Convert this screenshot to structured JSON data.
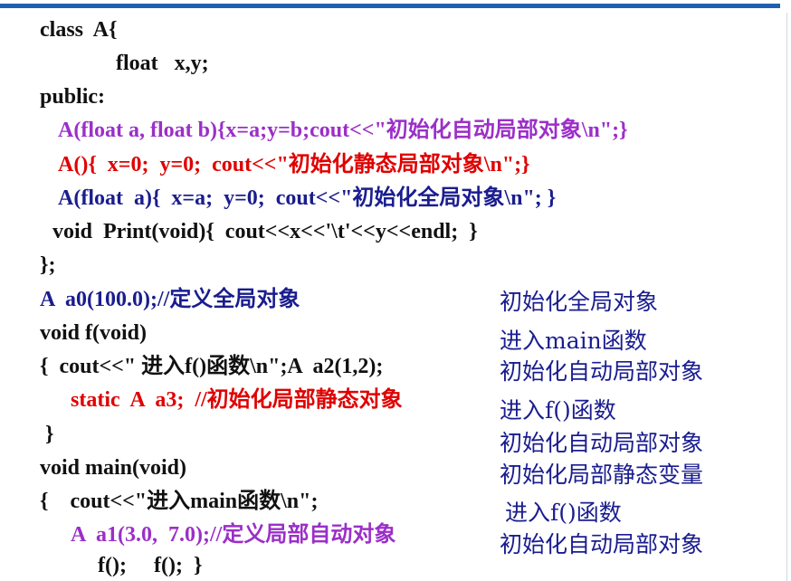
{
  "code_lines": [
    "class  A{",
    "float   x,y;",
    "public:",
    "A(float a, float b){x=a;y=b;cout<<\"初始化自动局部对象\\n\";}",
    "A(){  x=0;  y=0;  cout<<\"初始化静态局部对象\\n\";}",
    "A(float  a){  x=a;  y=0;  cout<<\"初始化全局对象\\n\"; }",
    "void  Print(void){  cout<<x<<'\\t'<<y<<endl;  }",
    "};",
    "A  a0(100.0);//定义全局对象",
    "void f(void)",
    "{  cout<<\" 进入f()函数\\n\";A  a2(1,2);",
    "static  A  a3;  //初始化局部静态对象",
    "}",
    "void main(void)",
    "{    cout<<\"进入main函数\\n\";",
    "A  a1(3.0,  7.0);//定义局部自动对象",
    "f();     f();  }"
  ],
  "output_lines": [
    "初始化全局对象",
    "进入main函数",
    "初始化自动局部对象",
    "进入f()函数",
    "初始化自动局部对象",
    "初始化局部静态变量",
    "进入f()函数",
    "初始化自动局部对象"
  ],
  "colors": {
    "accent_bar": "#1f5fb0",
    "code_black": "#111111",
    "code_purple": "#9b2fc8",
    "code_red": "#e00000",
    "code_navy": "#1a1d8e",
    "output_navy": "#1a1d8e"
  }
}
